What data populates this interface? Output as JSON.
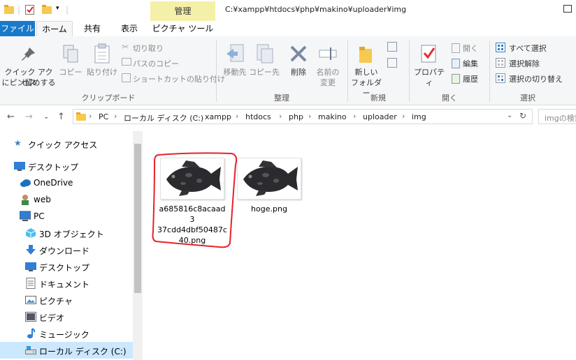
{
  "titlebar": {
    "context_tab": "管理",
    "path": "C:¥xampp¥htdocs¥php¥makino¥uploader¥img"
  },
  "tabs": [
    "ファイル",
    "ホーム",
    "共有",
    "表示",
    "ピクチャ ツール"
  ],
  "ribbon": {
    "clipboard": {
      "pin": [
        "クイック アクセス",
        "にピン留めする"
      ],
      "copy": "コピー",
      "paste": "貼り付け",
      "cut": "切り取り",
      "copy_path": "パスのコピー",
      "paste_shortcut": "ショートカットの貼り付け",
      "group": "クリップボード"
    },
    "organize": {
      "move_to": "移動先",
      "copy_to": "コピー先",
      "delete": "削除",
      "rename": [
        "名前の",
        "変更"
      ],
      "group": "整理"
    },
    "new": {
      "new_folder": [
        "新しい",
        "フォルダー"
      ],
      "group": "新規"
    },
    "open": {
      "properties": "プロパティ",
      "open": "開く",
      "edit": "編集",
      "history": "履歴",
      "group": "開く"
    },
    "select": {
      "select_all": "すべて選択",
      "select_none": "選択解除",
      "invert": "選択の切り替え",
      "group": "選択"
    }
  },
  "address": {
    "crumbs": [
      "PC",
      "ローカル ディスク (C:)",
      "xampp",
      "htdocs",
      "php",
      "makino",
      "uploader",
      "img"
    ],
    "search_placeholder": "imgの検索"
  },
  "nav": [
    {
      "label": "クイック アクセス",
      "icon": "star-icon"
    },
    {
      "label": "デスクトップ",
      "icon": "desktop-icon"
    },
    {
      "label": "OneDrive",
      "icon": "cloud-icon"
    },
    {
      "label": "web",
      "icon": "user-icon"
    },
    {
      "label": "PC",
      "icon": "pc-icon"
    },
    {
      "label": "3D オブジェクト",
      "icon": "cube-icon"
    },
    {
      "label": "ダウンロード",
      "icon": "download-icon"
    },
    {
      "label": "デスクトップ",
      "icon": "desktop-icon"
    },
    {
      "label": "ドキュメント",
      "icon": "document-icon"
    },
    {
      "label": "ピクチャ",
      "icon": "picture-icon"
    },
    {
      "label": "ビデオ",
      "icon": "video-icon"
    },
    {
      "label": "ミュージック",
      "icon": "music-icon"
    },
    {
      "label": "ローカル ディスク (C:)",
      "icon": "drive-icon"
    }
  ],
  "files": [
    {
      "name_lines": [
        "a685816c8acaad3",
        "37cdd4dbf50487c",
        "40.png"
      ],
      "highlighted": true
    },
    {
      "name_lines": [
        "hoge.png"
      ],
      "highlighted": false
    }
  ],
  "colors": {
    "accent": "#1979ca",
    "context_tab": "#f5f0a8",
    "selection": "#cce8ff",
    "highlight_circle": "#e8202a"
  }
}
